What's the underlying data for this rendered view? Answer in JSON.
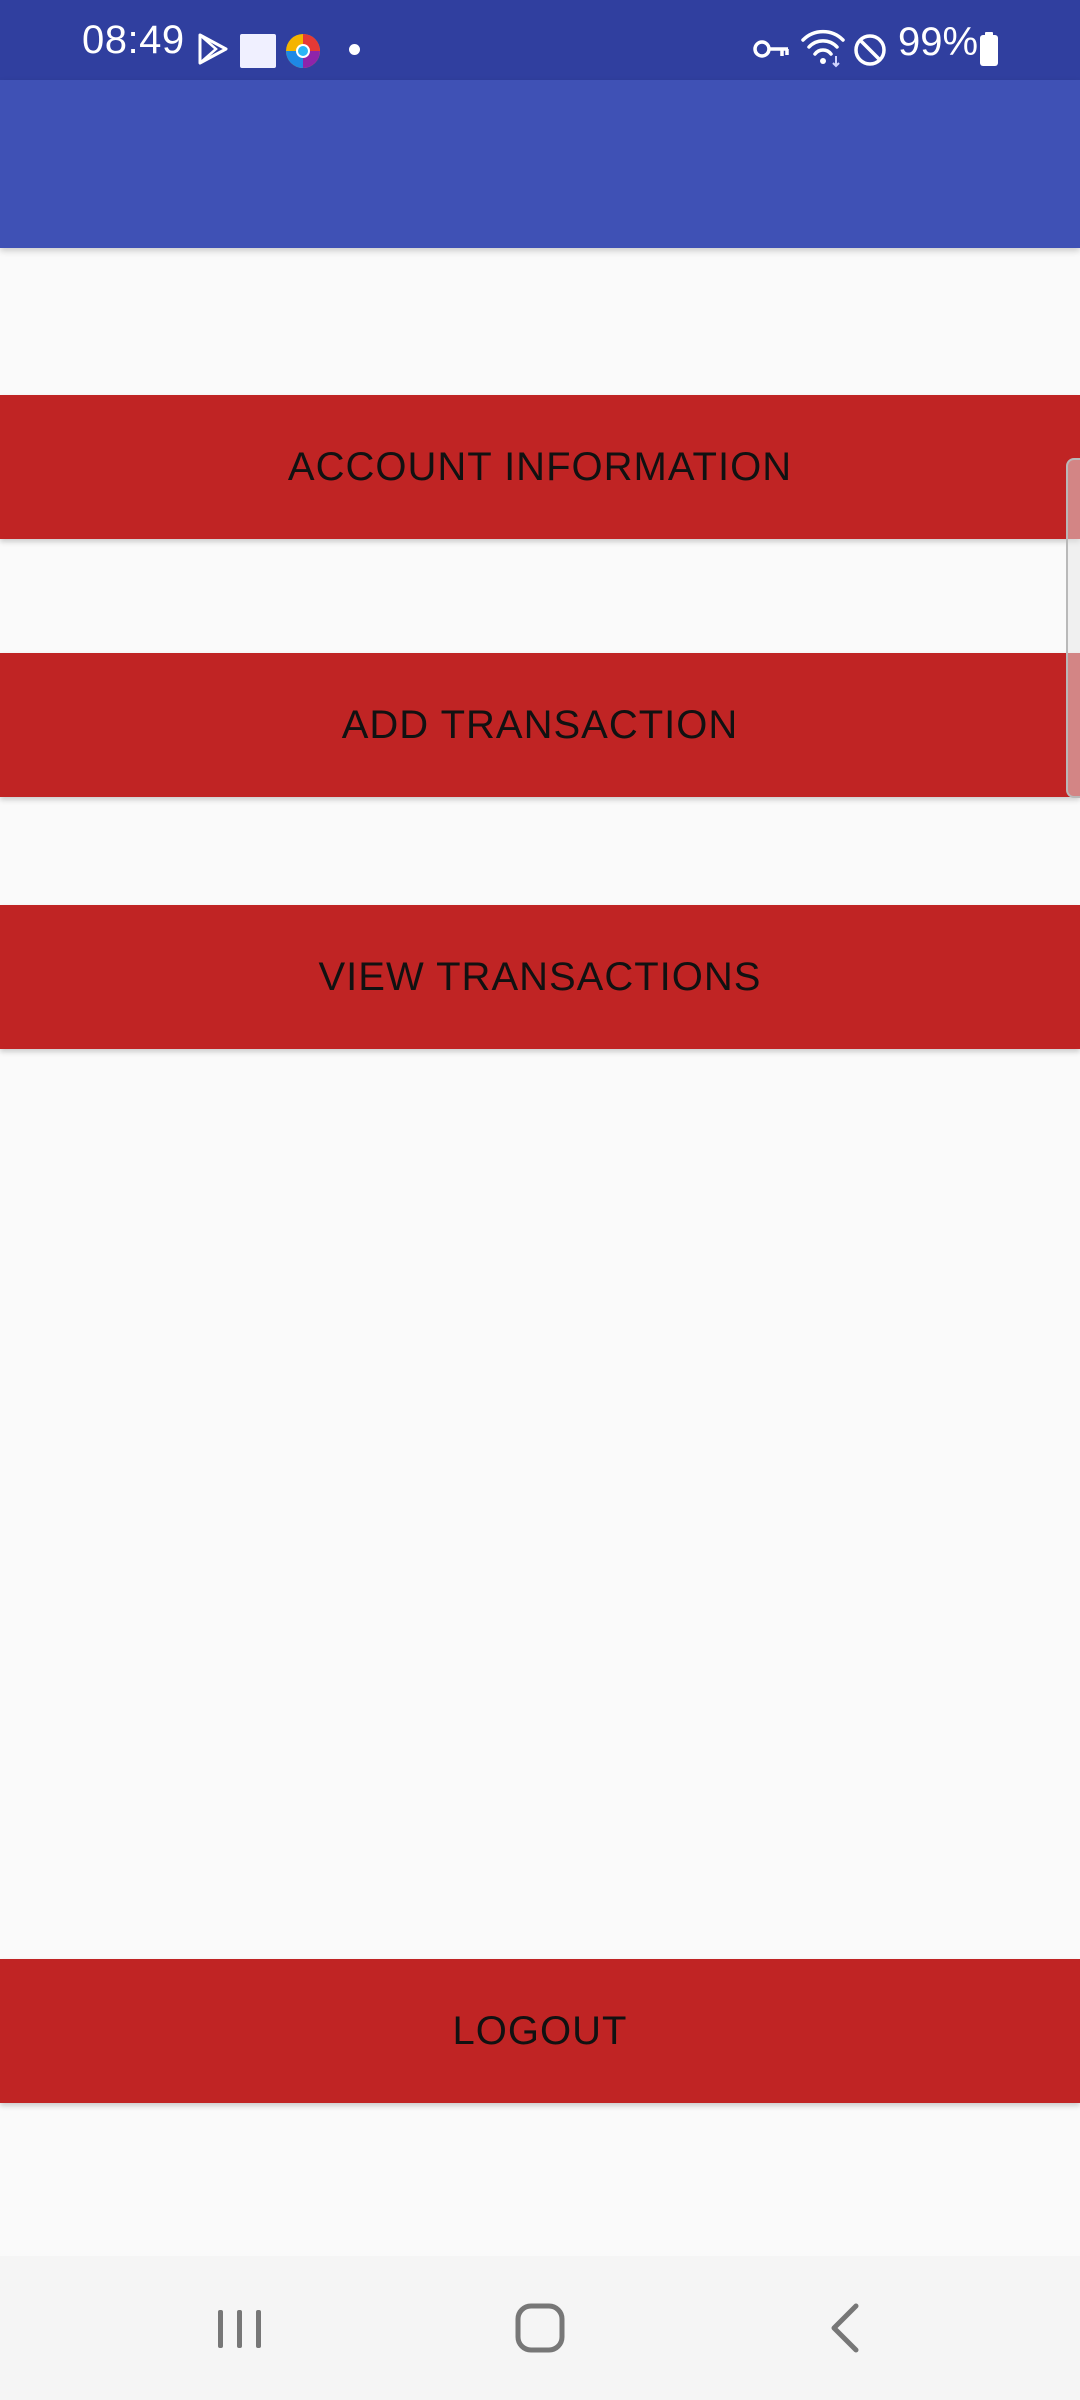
{
  "status_bar": {
    "time": "08:49",
    "battery_percent": "99%",
    "icons": [
      "play-store-icon",
      "square-notification-icon",
      "browser-icon",
      "dot-icon",
      "vpn-key-icon",
      "wifi-icon",
      "do-not-disturb-icon",
      "battery-icon"
    ]
  },
  "app_bar": {
    "title": ""
  },
  "menu": {
    "account_information": "ACCOUNT INFORMATION",
    "add_transaction": "ADD TRANSACTION",
    "view_transactions": "VIEW TRANSACTIONS",
    "logout": "LOGOUT"
  },
  "colors": {
    "status_bar": "#303f9f",
    "app_bar": "#3f51b5",
    "button": "#c02424",
    "background": "#fafafa",
    "nav_bar": "#f5f5f5"
  },
  "nav_bar": {
    "icons": [
      "recents-icon",
      "home-icon",
      "back-icon"
    ]
  }
}
